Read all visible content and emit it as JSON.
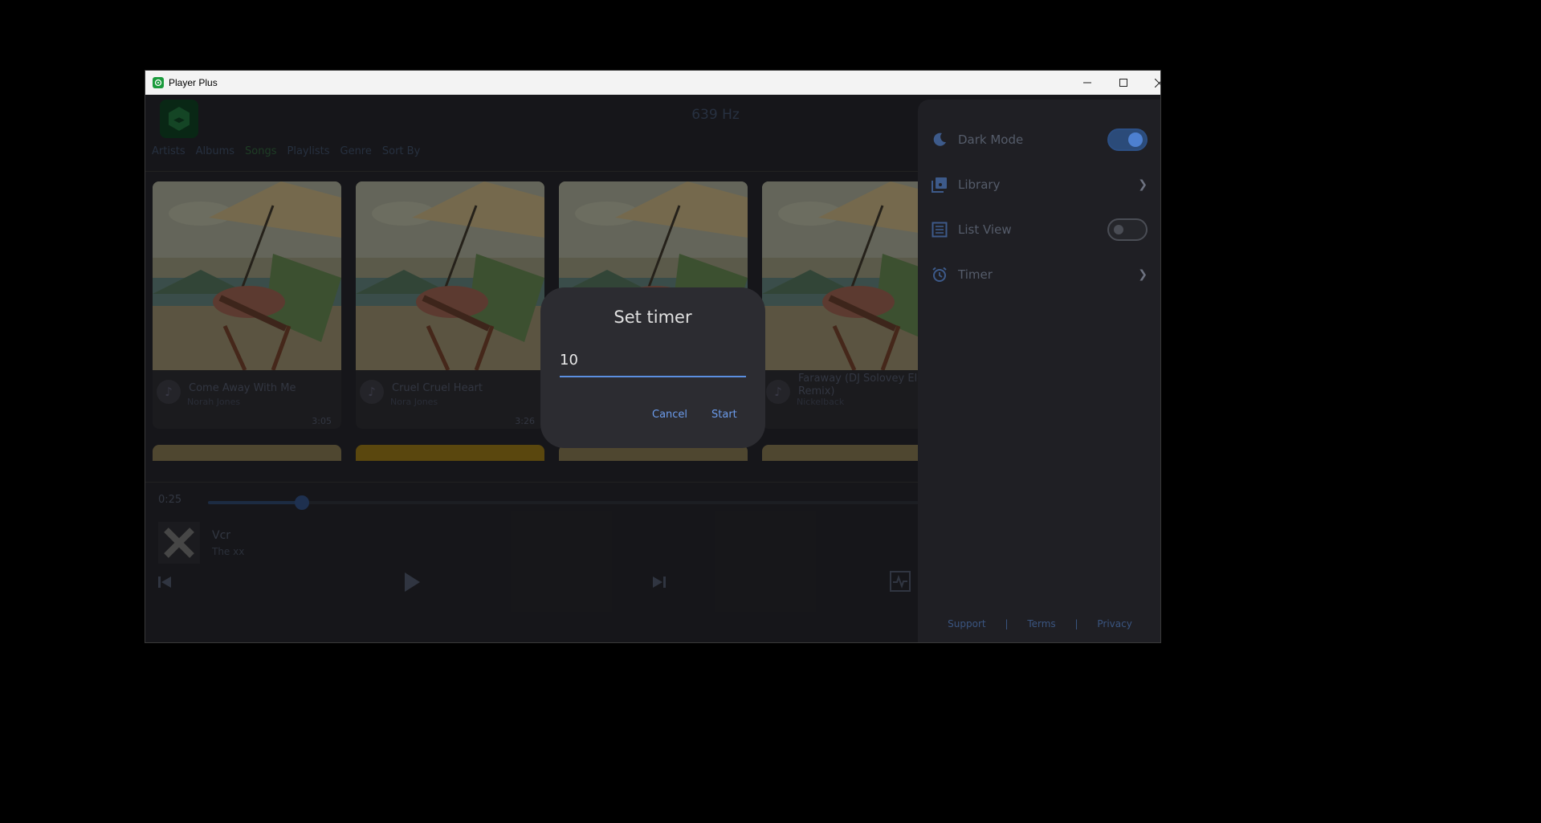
{
  "window": {
    "title": "Player Plus"
  },
  "header": {
    "frequency": "639 Hz"
  },
  "tabs": [
    {
      "label": "Artists"
    },
    {
      "label": "Albums"
    },
    {
      "label": "Songs"
    },
    {
      "label": "Playlists"
    },
    {
      "label": "Genre"
    },
    {
      "label": "Sort By"
    }
  ],
  "songs": [
    {
      "title": "Come Away With Me",
      "artist": "Norah Jones",
      "duration": "3:05"
    },
    {
      "title": "Cruel Cruel Heart",
      "artist": "Nora Jones",
      "duration": "3:26"
    },
    {
      "title": "",
      "artist": "",
      "duration": ""
    },
    {
      "title": "Faraway (DJ Solovey Ele Remix)",
      "artist": "Nickelback",
      "duration": ""
    }
  ],
  "player": {
    "elapsed": "0:25",
    "progress_fraction": 0.13,
    "track_title": "Vcr",
    "track_artist": "The xx"
  },
  "drawer": {
    "dark_mode_label": "Dark Mode",
    "dark_mode_on": true,
    "library_label": "Library",
    "list_view_label": "List View",
    "list_view_on": false,
    "timer_label": "Timer",
    "footer": {
      "support": "Support",
      "terms": "Terms",
      "privacy": "Privacy",
      "separator": "|"
    }
  },
  "dialog": {
    "title": "Set timer",
    "value": "10",
    "cancel_label": "Cancel",
    "start_label": "Start"
  },
  "colors": {
    "accent": "#5b8fe0",
    "brand": "#1a9b3c"
  }
}
